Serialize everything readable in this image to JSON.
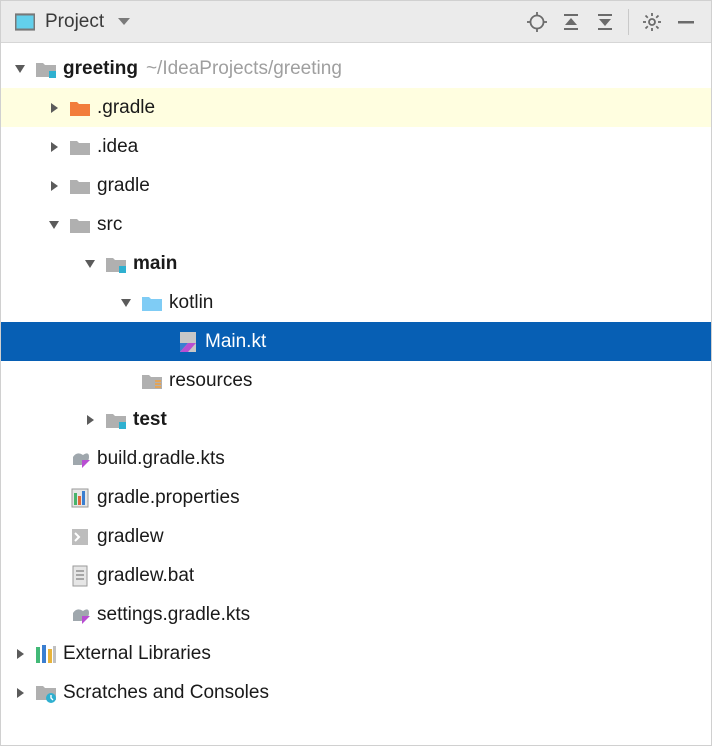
{
  "header": {
    "title": "Project"
  },
  "tree": {
    "root": {
      "name": "greeting",
      "path": "~/IdeaProjects/greeting"
    },
    "items": [
      {
        "label": ".gradle"
      },
      {
        "label": ".idea"
      },
      {
        "label": "gradle"
      },
      {
        "label": "src"
      },
      {
        "label": "main"
      },
      {
        "label": "kotlin"
      },
      {
        "label": "Main.kt"
      },
      {
        "label": "resources"
      },
      {
        "label": "test"
      },
      {
        "label": "build.gradle.kts"
      },
      {
        "label": "gradle.properties"
      },
      {
        "label": "gradlew"
      },
      {
        "label": "gradlew.bat"
      },
      {
        "label": "settings.gradle.kts"
      }
    ],
    "external": "External Libraries",
    "scratches": "Scratches and Consoles"
  }
}
